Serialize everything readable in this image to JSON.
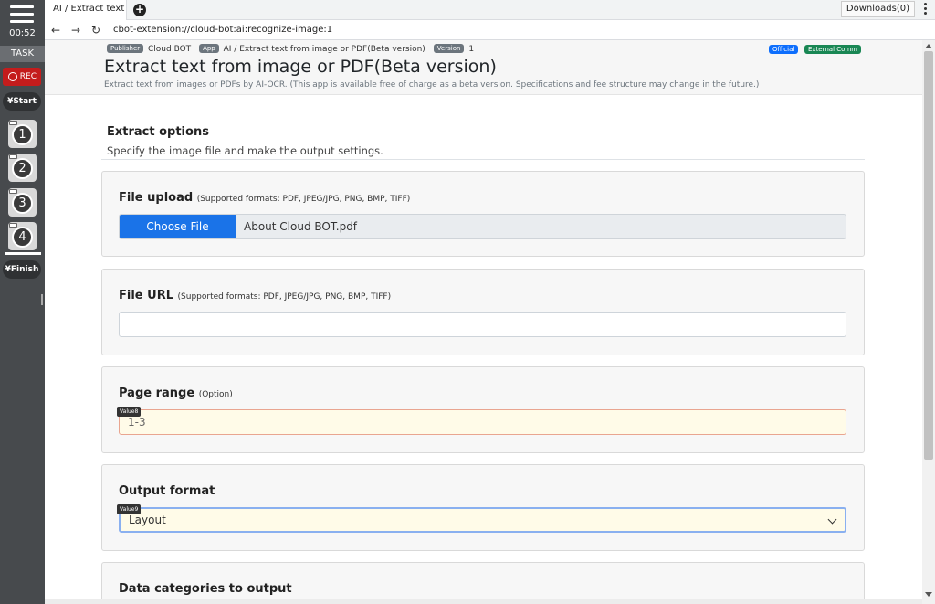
{
  "sidebar": {
    "timer": "00:52",
    "task_label": "TASK",
    "rec_label": "REC",
    "start_label": "¥Start",
    "steps": [
      "1",
      "2",
      "3",
      "4"
    ],
    "finish_label": "¥Finish"
  },
  "browser": {
    "tab_title": "AI / Extract text fr",
    "downloads_label": "Downloads(0)",
    "url": "cbot-extension://cloud-bot:ai:recognize-image:1"
  },
  "app": {
    "publisher_badge": "Publisher",
    "publisher": "Cloud BOT",
    "app_badge": "App",
    "app_path": "AI / Extract text from image or PDF(Beta version)",
    "version_badge": "Version",
    "version": "1",
    "official_badge": "Official",
    "external_badge": "External Comm",
    "title": "Extract text from image or PDF(Beta version)",
    "description": "Extract text from images or PDFs by AI-OCR. (This app is available free of charge as a beta version. Specifications and fee structure may change in the future.)"
  },
  "section": {
    "title": "Extract options",
    "description": "Specify the image file and make the output settings."
  },
  "file_upload": {
    "label": "File upload",
    "formats": "(Supported formats: PDF, JPEG/JPG, PNG, BMP, TIFF)",
    "button_label": "Choose File",
    "file_name": "About Cloud BOT.pdf"
  },
  "file_url": {
    "label": "File URL",
    "formats": "(Supported formats: PDF, JPEG/JPG, PNG, BMP, TIFF)",
    "value": ""
  },
  "page_range": {
    "label": "Page range",
    "option": "(Option)",
    "value_tag": "Value8",
    "value": "1-3"
  },
  "output_format": {
    "label": "Output format",
    "value_tag": "Value9",
    "selected": "Layout"
  },
  "data_categories": {
    "label": "Data categories to output"
  }
}
